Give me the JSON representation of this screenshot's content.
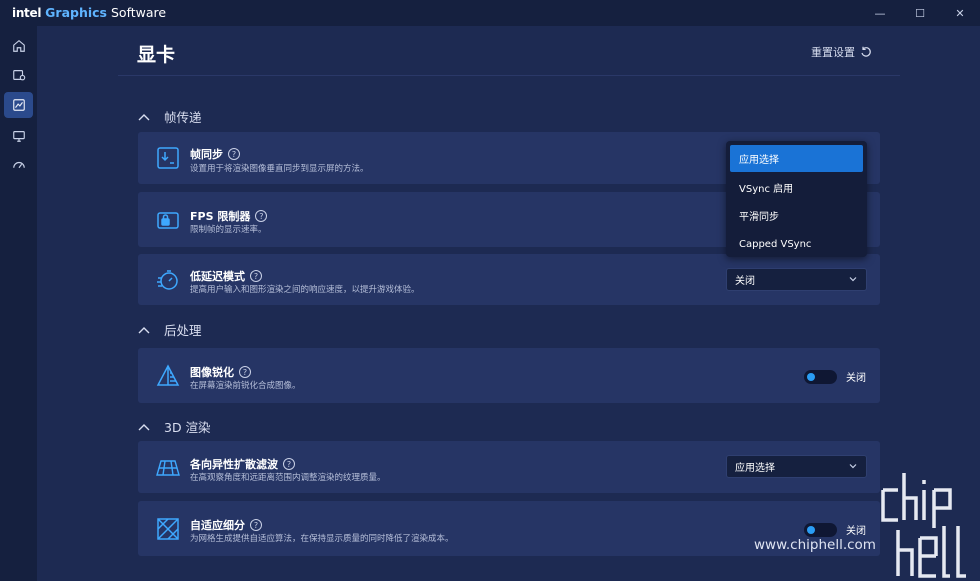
{
  "app": {
    "brand_intel": "intel",
    "brand_graphics": "Graphics",
    "brand_software": "Software"
  },
  "window_controls": {
    "minimize": "—",
    "maximize": "☐",
    "close": "✕"
  },
  "rail": [
    {
      "icon": "home-icon"
    },
    {
      "icon": "apps-icon"
    },
    {
      "icon": "graphics-icon",
      "active": true
    },
    {
      "icon": "display-icon"
    },
    {
      "icon": "performance-icon"
    }
  ],
  "header": {
    "title": "显卡",
    "reset_label": "重置设置"
  },
  "sections": {
    "frame_delivery": "帧传递",
    "post_processing": "后处理",
    "rendering_3d": "3D 渲染"
  },
  "settings": {
    "vsync": {
      "title": "帧同步",
      "desc": "设置用于将渲染图像垂直同步到显示屏的方法。"
    },
    "fps_limiter": {
      "title": "FPS 限制器",
      "desc": "限制帧的显示速率。"
    },
    "low_latency": {
      "title": "低延迟模式",
      "desc": "提高用户输入和图形渲染之间的响应速度，以提升游戏体验。",
      "value": "关闭"
    },
    "sharpening": {
      "title": "图像锐化",
      "desc": "在屏幕渲染前锐化合成图像。",
      "state": "关闭"
    },
    "anisotropic": {
      "title": "各向异性扩散滤波",
      "desc": "在高观察角度和远距离范围内调整渲染的纹理质量。",
      "value": "应用选择"
    },
    "adaptive_tess": {
      "title": "自适应细分",
      "desc": "为网格生成提供自适应算法，在保持显示质量的同时降低了渲染成本。",
      "state": "关闭"
    }
  },
  "vsync_menu": {
    "options": [
      "应用选择",
      "VSync 启用",
      "平滑同步",
      "Capped VSync"
    ],
    "selected": "应用选择"
  },
  "watermark": {
    "url": "www.chiphell.com"
  },
  "colors": {
    "accent": "#1a73d6",
    "toggle_knob": "#2a9df4",
    "card": "#263565",
    "background": "#1d2a52"
  }
}
